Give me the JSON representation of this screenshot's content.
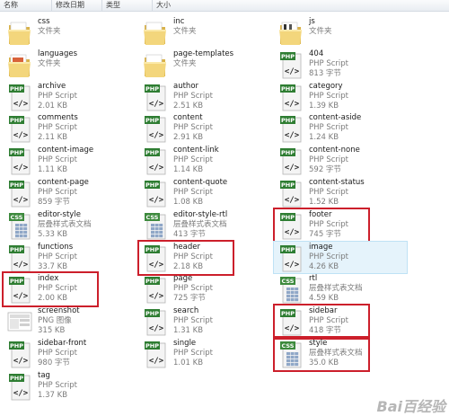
{
  "header": {
    "col_name": "名称",
    "col_modified": "修改日期",
    "col_type": "类型",
    "col_size": "大小"
  },
  "watermark": "Bai百经验",
  "columns": [
    [
      {
        "name": "css",
        "type": "文件夹",
        "size": "",
        "icon": "folder"
      },
      {
        "name": "languages",
        "type": "文件夹",
        "size": "",
        "icon": "folder-docs"
      },
      {
        "name": "archive",
        "type": "PHP Script",
        "size": "2.01 KB",
        "icon": "php"
      },
      {
        "name": "comments",
        "type": "PHP Script",
        "size": "2.11 KB",
        "icon": "php"
      },
      {
        "name": "content-image",
        "type": "PHP Script",
        "size": "1.11 KB",
        "icon": "php"
      },
      {
        "name": "content-page",
        "type": "PHP Script",
        "size": "859 字节",
        "icon": "php"
      },
      {
        "name": "editor-style",
        "type": "层叠样式表文档",
        "size": "5.33 KB",
        "icon": "css"
      },
      {
        "name": "functions",
        "type": "PHP Script",
        "size": "33.7 KB",
        "icon": "php"
      },
      {
        "name": "index",
        "type": "PHP Script",
        "size": "2.00 KB",
        "icon": "php",
        "highlight": true
      },
      {
        "name": "screenshot",
        "type": "PNG 图像",
        "size": "315 KB",
        "icon": "png"
      },
      {
        "name": "sidebar-front",
        "type": "PHP Script",
        "size": "980 字节",
        "icon": "php"
      },
      {
        "name": "tag",
        "type": "PHP Script",
        "size": "1.37 KB",
        "icon": "php"
      }
    ],
    [
      {
        "name": "inc",
        "type": "文件夹",
        "size": "",
        "icon": "folder"
      },
      {
        "name": "page-templates",
        "type": "文件夹",
        "size": "",
        "icon": "folder"
      },
      {
        "name": "author",
        "type": "PHP Script",
        "size": "2.51 KB",
        "icon": "php"
      },
      {
        "name": "content",
        "type": "PHP Script",
        "size": "2.91 KB",
        "icon": "php"
      },
      {
        "name": "content-link",
        "type": "PHP Script",
        "size": "1.14 KB",
        "icon": "php"
      },
      {
        "name": "content-quote",
        "type": "PHP Script",
        "size": "1.08 KB",
        "icon": "php"
      },
      {
        "name": "editor-style-rtl",
        "type": "层叠样式表文档",
        "size": "413 字节",
        "icon": "css"
      },
      {
        "name": "header",
        "type": "PHP Script",
        "size": "2.18 KB",
        "icon": "php",
        "highlight": true
      },
      {
        "name": "page",
        "type": "PHP Script",
        "size": "725 字节",
        "icon": "php"
      },
      {
        "name": "search",
        "type": "PHP Script",
        "size": "1.31 KB",
        "icon": "php"
      },
      {
        "name": "single",
        "type": "PHP Script",
        "size": "1.01 KB",
        "icon": "php"
      }
    ],
    [
      {
        "name": "js",
        "type": "文件夹",
        "size": "",
        "icon": "folder-js"
      },
      {
        "name": "404",
        "type": "PHP Script",
        "size": "813 字节",
        "icon": "php"
      },
      {
        "name": "category",
        "type": "PHP Script",
        "size": "1.39 KB",
        "icon": "php"
      },
      {
        "name": "content-aside",
        "type": "PHP Script",
        "size": "1.24 KB",
        "icon": "php"
      },
      {
        "name": "content-none",
        "type": "PHP Script",
        "size": "592 字节",
        "icon": "php"
      },
      {
        "name": "content-status",
        "type": "PHP Script",
        "size": "1.52 KB",
        "icon": "php"
      },
      {
        "name": "footer",
        "type": "PHP Script",
        "size": "745 字节",
        "icon": "php",
        "highlight": true
      },
      {
        "name": "image",
        "type": "PHP Script",
        "size": "4.26 KB",
        "icon": "php",
        "selected": true
      },
      {
        "name": "rtl",
        "type": "层叠样式表文档",
        "size": "4.59 KB",
        "icon": "css"
      },
      {
        "name": "sidebar",
        "type": "PHP Script",
        "size": "418 字节",
        "icon": "php",
        "highlight": true
      },
      {
        "name": "style",
        "type": "层叠样式表文档",
        "size": "35.0 KB",
        "icon": "css",
        "highlight": true
      }
    ]
  ]
}
